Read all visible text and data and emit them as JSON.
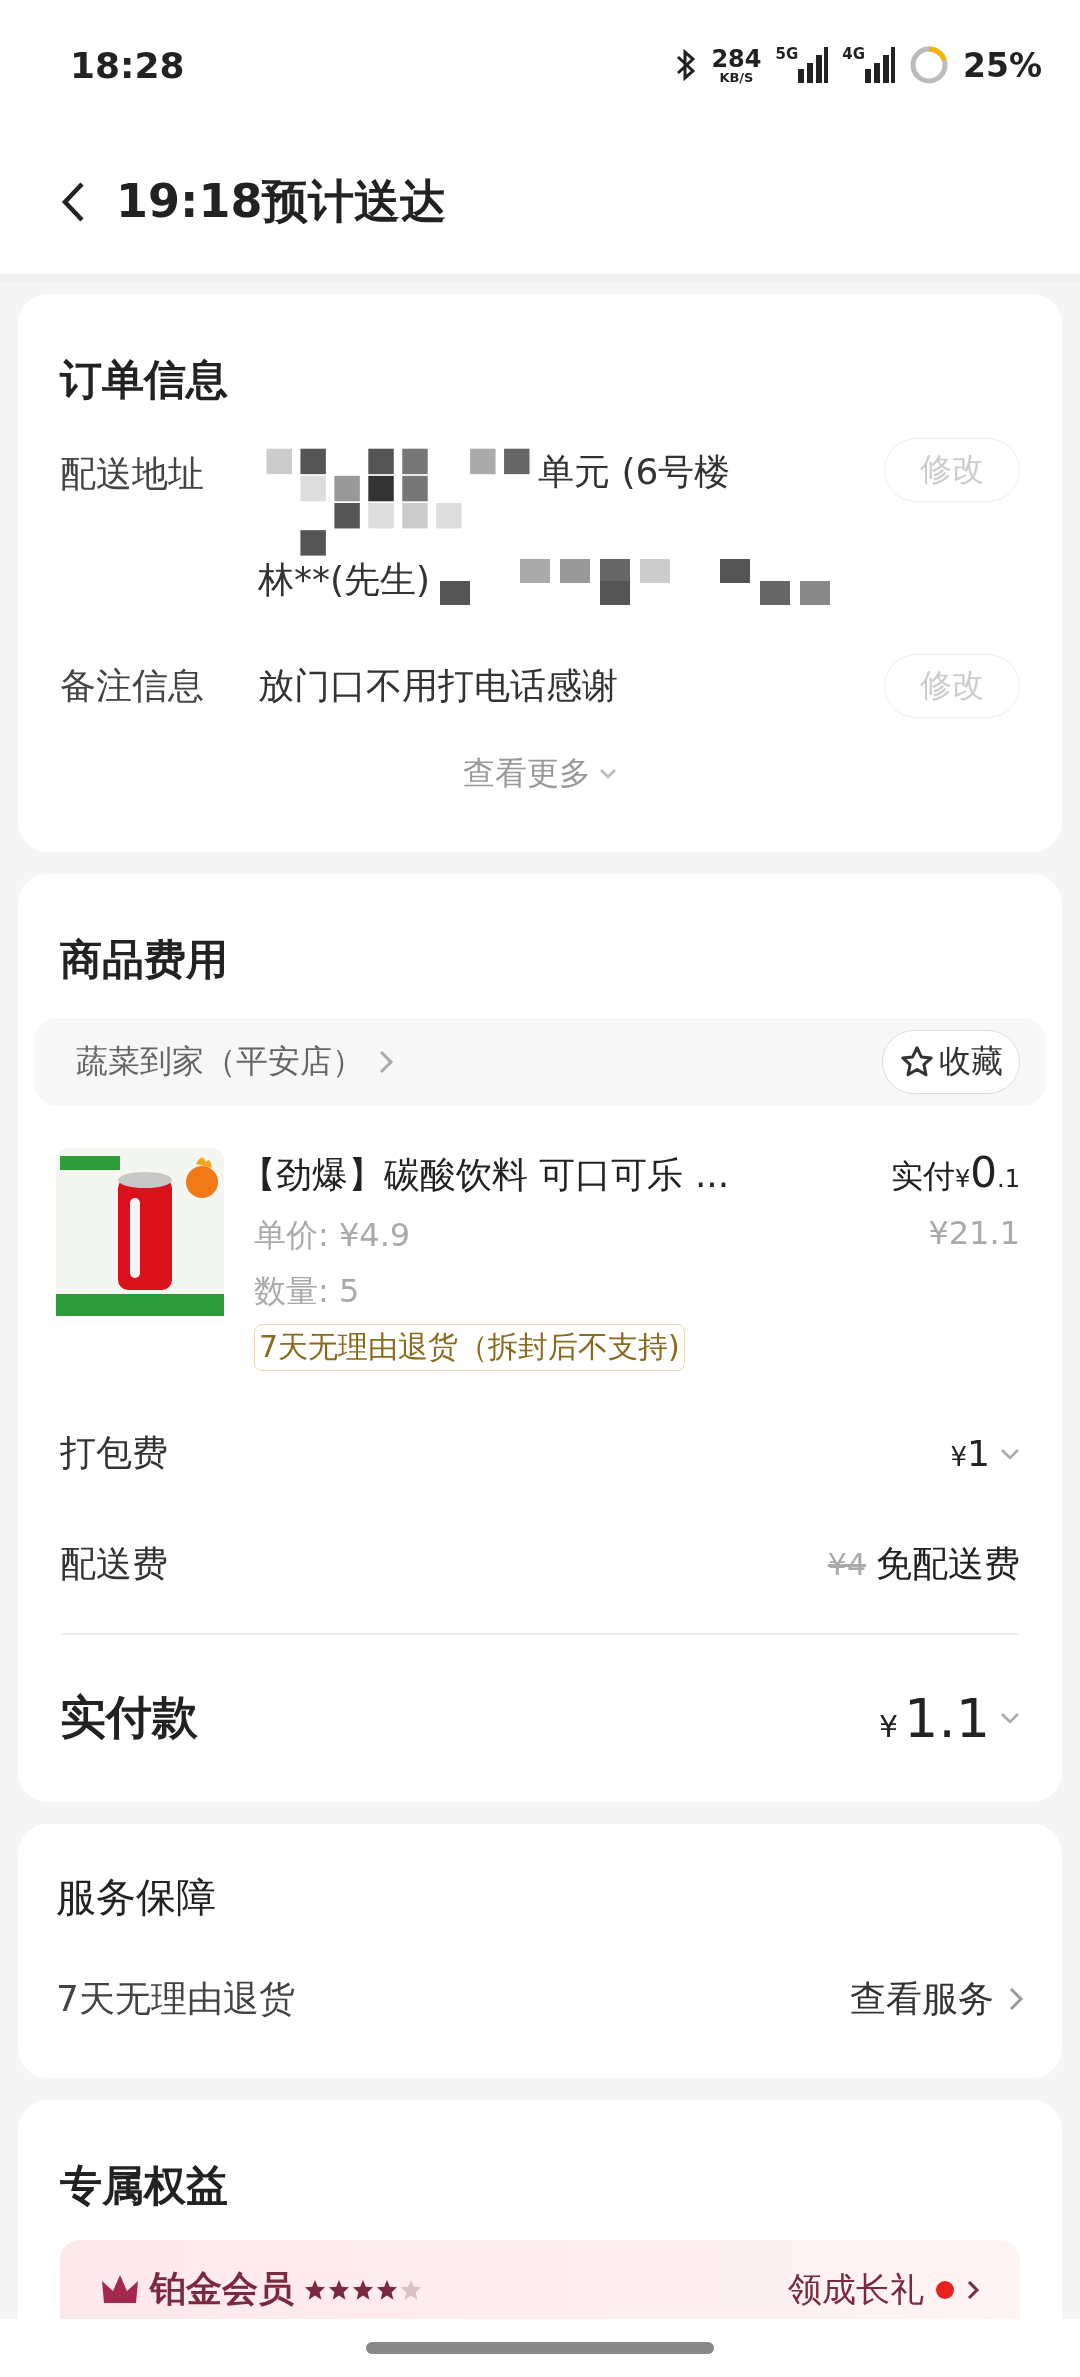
{
  "status_bar": {
    "time": "18:28",
    "net_speed": "284",
    "net_unit": "KB/S",
    "sim_1": "5G",
    "sim_2": "4G",
    "battery": "25%"
  },
  "header": {
    "title": "19:18预计送达"
  },
  "order_info": {
    "title": "订单信息",
    "address": {
      "label": "配送地址",
      "line_1": "单元 (6号楼",
      "line_2": "林**(先生)",
      "button": "修改"
    },
    "note": {
      "label": "备注信息",
      "value": "放门口不用打电话感谢",
      "button": "修改"
    },
    "more": "查看更多"
  },
  "goods": {
    "title": "商品费用",
    "store": "蔬菜到家（平安店）",
    "favorite": "收藏",
    "product": {
      "kind": "picture",
      "name": "【劲爆】碳酸饮料 可口可乐 ...",
      "paid_label": "实付",
      "paid_currency": "¥",
      "paid_integer": "0",
      "paid_decimal": ".1",
      "original_price": "¥21.1",
      "unit_price": "单价: ¥4.9",
      "quantity": "数量: 5",
      "tag": "7天无理由退货（拆封后不支持)"
    },
    "fees": [
      {
        "kind": "expandable",
        "label": "打包费",
        "currency": "¥",
        "amount": "1"
      },
      {
        "kind": "waived",
        "label": "配送费",
        "old_amount": "¥4",
        "note": "免配送费"
      }
    ],
    "total": {
      "label": "实付款",
      "currency": "¥",
      "amount": "1.1"
    }
  },
  "service": {
    "title": "服务保障",
    "item": "7天无理由退货",
    "link": "查看服务"
  },
  "benefits": {
    "title": "专属权益",
    "member": "铂金会员",
    "stars": 4,
    "gift": "领成长礼",
    "unread": true
  }
}
